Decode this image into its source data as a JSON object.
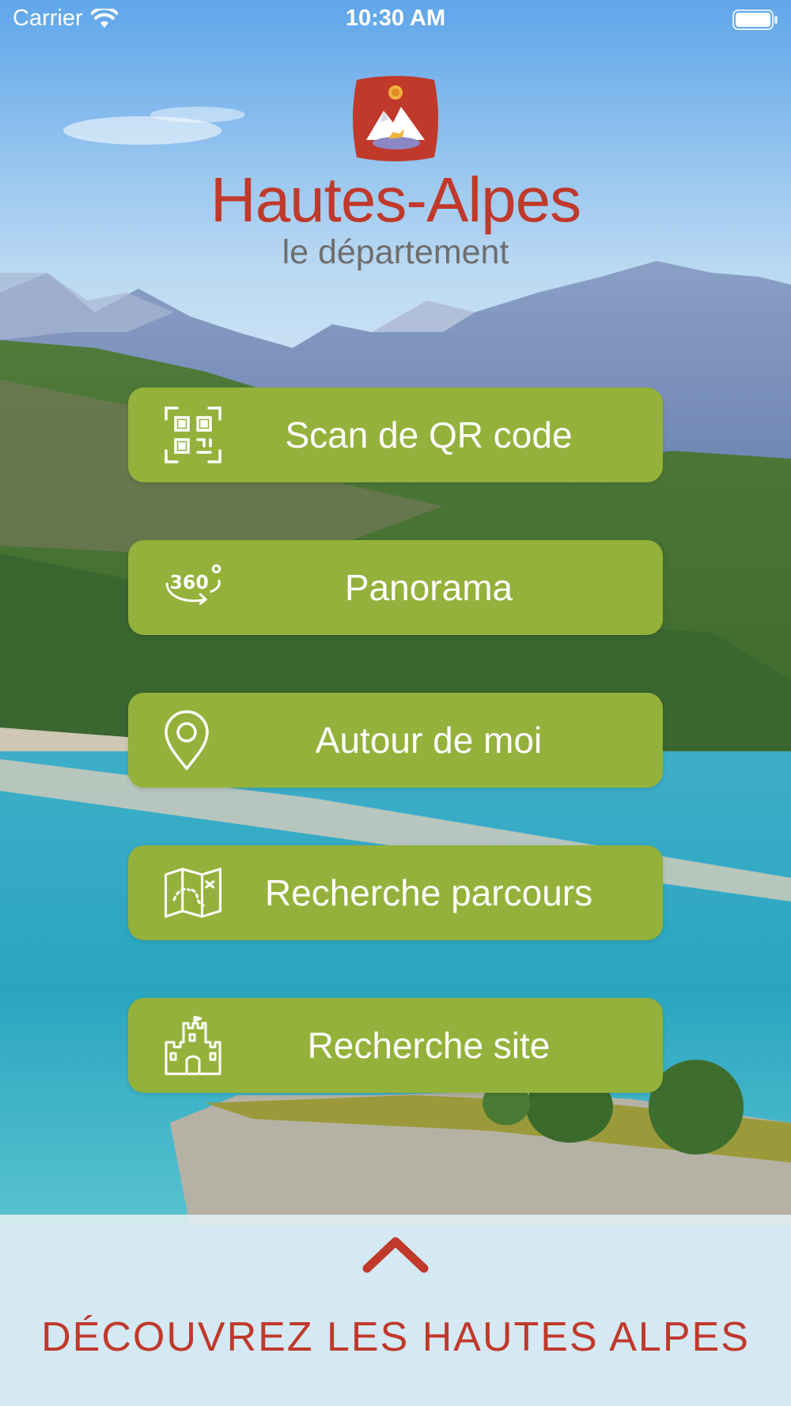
{
  "status_bar": {
    "carrier": "Carrier",
    "time": "10:30 AM"
  },
  "logo": {
    "title": "Hautes-Alpes",
    "subtitle": "le département"
  },
  "menu": {
    "items": [
      {
        "label": "Scan de QR code",
        "icon": "qr-code-icon"
      },
      {
        "label": "Panorama",
        "icon": "panorama-360-icon"
      },
      {
        "label": "Autour de moi",
        "icon": "location-pin-icon"
      },
      {
        "label": "Recherche parcours",
        "icon": "map-route-icon"
      },
      {
        "label": "Recherche site",
        "icon": "castle-icon"
      }
    ]
  },
  "bottom_panel": {
    "discover_label": "DÉCOUVREZ LES HAUTES ALPES",
    "chevron_icon": "chevron-up-icon"
  },
  "colors": {
    "button_green": "#94b13b",
    "brand_red": "#c0392b",
    "subtitle_gray": "#6e6e6e",
    "lake_turquoise": "#2aa5c0"
  }
}
